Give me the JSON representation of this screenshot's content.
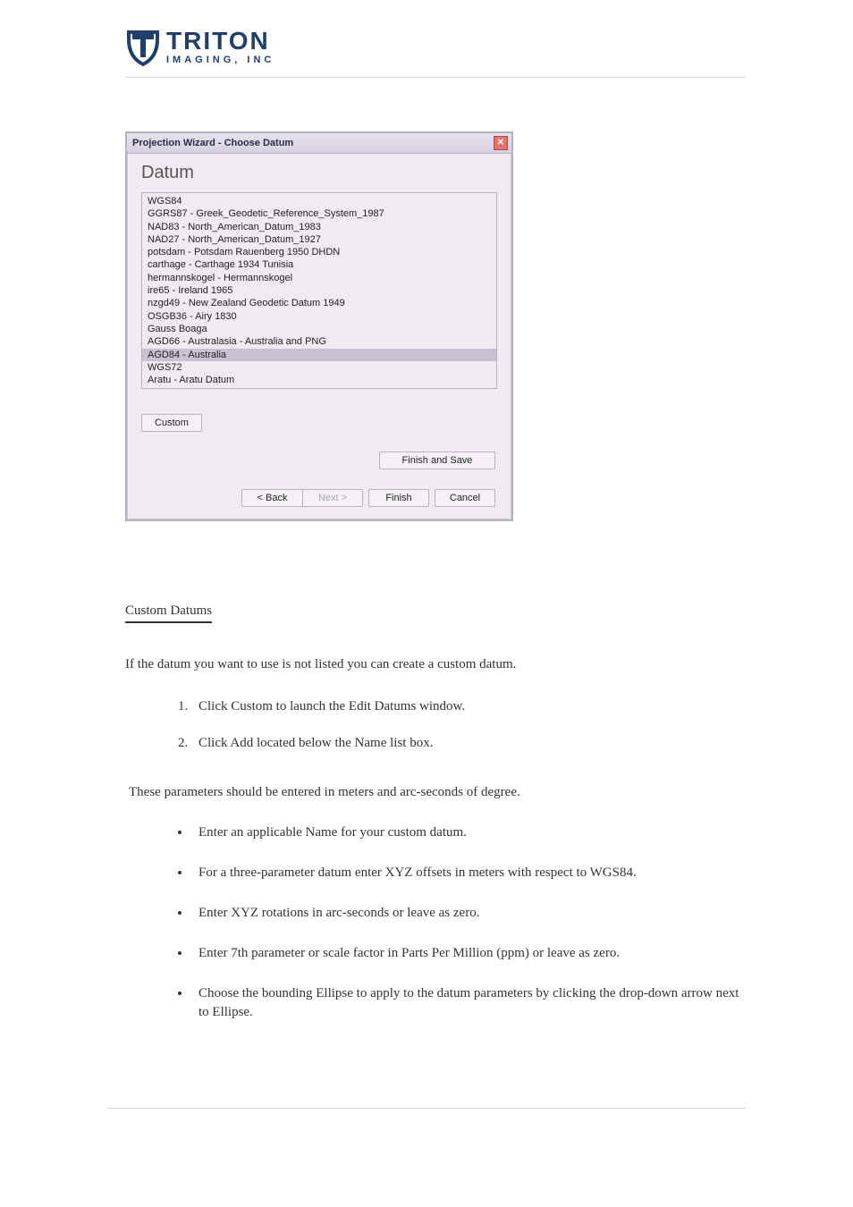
{
  "brand": {
    "name": "TRITON",
    "sub": "IMAGING, INC"
  },
  "dialog": {
    "title": "Projection Wizard - Choose Datum",
    "section_label": "Datum",
    "items": [
      "WGS84",
      "GGRS87 - Greek_Geodetic_Reference_System_1987",
      "NAD83 - North_American_Datum_1983",
      "NAD27 - North_American_Datum_1927",
      "potsdam - Potsdam Rauenberg 1950 DHDN",
      "carthage - Carthage 1934 Tunisia",
      "hermannskogel - Hermannskogel",
      "ire65 - Ireland 1965",
      "nzgd49 - New Zealand Geodetic Datum 1949",
      "OSGB36 - Airy 1830",
      "Gauss Boaga",
      "AGD66 - Australasia - Australia and PNG",
      "AGD84 - Australia",
      "WGS72",
      "Aratu - Aratu Datum"
    ],
    "selected_index": 12,
    "buttons": {
      "custom": "Custom",
      "finish_save": "Finish and Save",
      "back": "< Back",
      "next": "Next >",
      "finish": "Finish",
      "cancel": "Cancel"
    }
  },
  "doc": {
    "heading": "Custom Datums",
    "intro": "If the datum you want to use is not listed you can create a custom datum.",
    "steps": [
      "Click Custom to launch the Edit Datums window.",
      "Click Add located below the Name list box."
    ],
    "params_intro": "These parameters should be entered in meters and arc-seconds of degree.",
    "params": [
      "Enter an applicable Name for your custom datum.",
      "For a three-parameter datum enter XYZ offsets in meters with respect to WGS84.",
      "Enter XYZ rotations in arc-seconds or leave as zero.",
      "Enter 7th parameter or scale factor in Parts Per Million (ppm) or leave as zero.",
      "Choose the bounding Ellipse to apply to the datum parameters by clicking the drop-down arrow next to Ellipse."
    ]
  }
}
